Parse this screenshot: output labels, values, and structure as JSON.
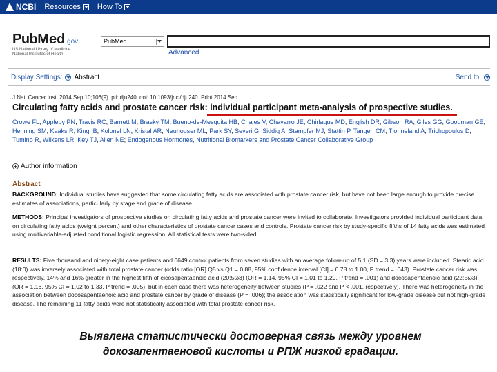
{
  "topbar": {
    "ncbi": "NCBI",
    "resources": "Resources",
    "howto": "How To"
  },
  "logo": {
    "pub": "Pub",
    "med": "Med",
    "gov": ".gov",
    "line1": "US National Library of Medicine",
    "line2": "National Institutes of Health"
  },
  "search": {
    "database": "PubMed",
    "query": "",
    "advanced": "Advanced"
  },
  "display": {
    "settings_label": "Display Settings:",
    "format": "Abstract",
    "send_to": "Send to:"
  },
  "article": {
    "citation": "J Natl Cancer Inst. 2014 Sep 10;106(9). pii: dju240. doi: 10.1093/jnci/dju240. Print 2014 Sep.",
    "title": "Circulating fatty acids and prostate cancer risk: individual participant meta-analysis of prospective studies.",
    "authors": [
      "Crowe FL",
      "Appleby PN",
      "Travis RC",
      "Barnett M",
      "Brasky TM",
      "Bueno-de-Mesquita HB",
      "Chajes V",
      "Chavarro JE",
      "Chirlaque MD",
      "English DR",
      "Gibson RA",
      "Giles GG",
      "Goodman GE",
      "Henning SM",
      "Kaaks R",
      "King IB",
      "Kolonel LN",
      "Kristal AR",
      "Neuhouser ML",
      "Park SY",
      "Severi G",
      "Siddiq A",
      "Stampfer MJ",
      "Stattin P",
      "Tangen CM",
      "Tjonneland A",
      "Trichopoulos D",
      "Tumino R",
      "Wilkens LR",
      "Key TJ",
      "Allen NE"
    ],
    "group": "Endogenous Hormones, Nutritional Biomarkers and Prostate Cancer Collaborative Group",
    "author_info": "Author information",
    "abstract_heading": "Abstract",
    "background_label": "BACKGROUND:",
    "background_text": "Individual studies have suggested that some circulating fatty acids are associated with prostate cancer risk, but have not been large enough to provide precise estimates of associations, particularly by stage and grade of disease.",
    "methods_label": "METHODS:",
    "methods_text": "Principal investigators of prospective studies on circulating fatty acids and prostate cancer were invited to collaborate. Investigators provided individual participant data on circulating fatty acids (weight percent) and other characteristics of prostate cancer cases and controls. Prostate cancer risk by study-specific fifths of 14 fatty acids was estimated using multivariable-adjusted conditional logistic regression. All statistical tests were two-sided.",
    "results_label": "RESULTS:",
    "results_text": "Five thousand and ninety-eight case patients and 6649 control patients from seven studies with an average follow-up of 5.1 (SD = 3.3) years were included. Stearic acid (18:0) was inversely associated with total prostate cancer (odds ratio [OR] Q5 vs Q1 = 0.88, 95% confidence interval [CI] = 0.78 to 1.00, P trend = .043). Prostate cancer risk was, respectively, 14% and 16% greater in the highest fifth of eicosapentaenoic acid (20:5ω3) (OR = 1.14, 95% CI = 1.01 to 1.29, P trend = .001) and docosapentaenoic acid (22:5ω3) (OR = 1.16, 95% CI = 1.02 to 1.33, P trend = .005), but in each case there was heterogeneity between studies (P = .022 and P < .001, respectively). There was heterogeneity in the association between docosapentaenoic acid and prostate cancer by grade of disease (P = .006); the association was statistically significant for low-grade disease but not high-grade disease. The remaining 11 fatty acids were not statistically associated with total prostate cancer risk."
  },
  "banner": {
    "line1": "Выявлена  статистически достоверная связь между уровнем",
    "line2": "докозапентаеновой  кислоты и РПЖ низкой градации."
  }
}
